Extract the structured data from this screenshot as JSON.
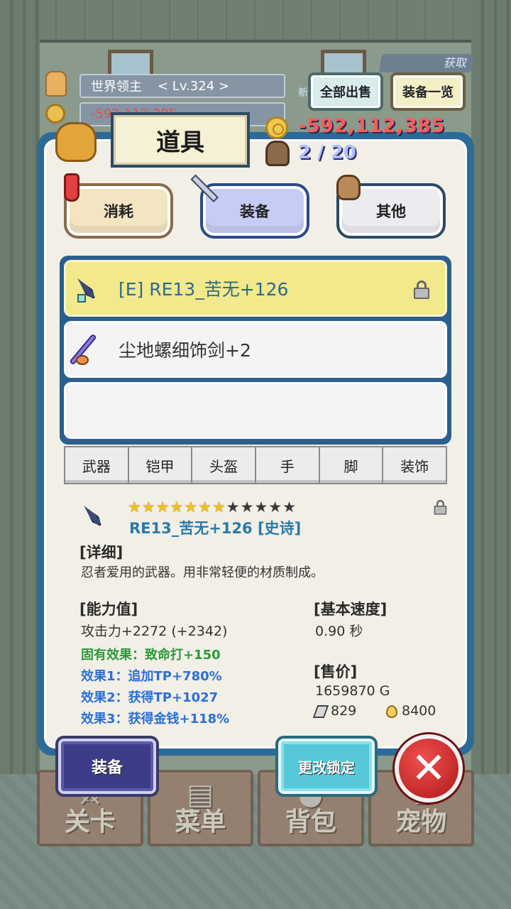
{
  "hud": {
    "boss_label": "世界领主",
    "boss_level": "< Lv.324 >",
    "gold_partial": "-592,112,385",
    "new_label": "新",
    "sell_all": "全部出售",
    "equip_list": "装备一览",
    "badge": "获取"
  },
  "dialog": {
    "title": "道具",
    "gold": "-592,112,385",
    "bag_count": "2 / 20",
    "categories": [
      "消耗",
      "装备",
      "其他"
    ],
    "active_category": "装备"
  },
  "items": [
    {
      "name": "[E] RE13_苦无+126",
      "selected": true,
      "locked": true,
      "icon": "kunai-icon"
    },
    {
      "name": "尘地螺细饰剑+2",
      "selected": false,
      "locked": false,
      "icon": "rapier-icon"
    },
    {
      "name": "",
      "selected": false,
      "locked": false,
      "icon": ""
    }
  ],
  "slot_tabs": [
    "武器",
    "铠甲",
    "头盔",
    "手",
    "脚",
    "装饰"
  ],
  "detail": {
    "stars_total": 12,
    "stars_filled": 7,
    "name": "RE13_苦无+126 [史诗]",
    "detail_label": "[详细]",
    "description": "忍者爱用的武器。用非常轻便的材质制成。",
    "stats_label": "[能力值]",
    "attack": "攻击力+2272 (+2342)",
    "inherent": "固有效果：致命打+150",
    "effect1": "效果1：追加TP+780%",
    "effect2": "效果2：获得TP+1027",
    "effect3": "效果3：获得金钱+118%",
    "speed_label": "[基本速度]",
    "speed": "0.90 秒",
    "price_label": "[售价]",
    "price": "1659870 G",
    "stone": "829",
    "drop": "8400"
  },
  "actions": {
    "equip": "装备",
    "change_lock": "更改锁定",
    "close": "✕"
  },
  "bottom_nav": [
    "关卡",
    "菜单",
    "背包",
    "宠物"
  ],
  "colors": {
    "dialog_border": "#2c6a98",
    "selected_row": "#f2e88c",
    "gold_text": "#ff5a5a",
    "effect_blue": "#2a70d8",
    "inherent_green": "#2a9a3a"
  }
}
